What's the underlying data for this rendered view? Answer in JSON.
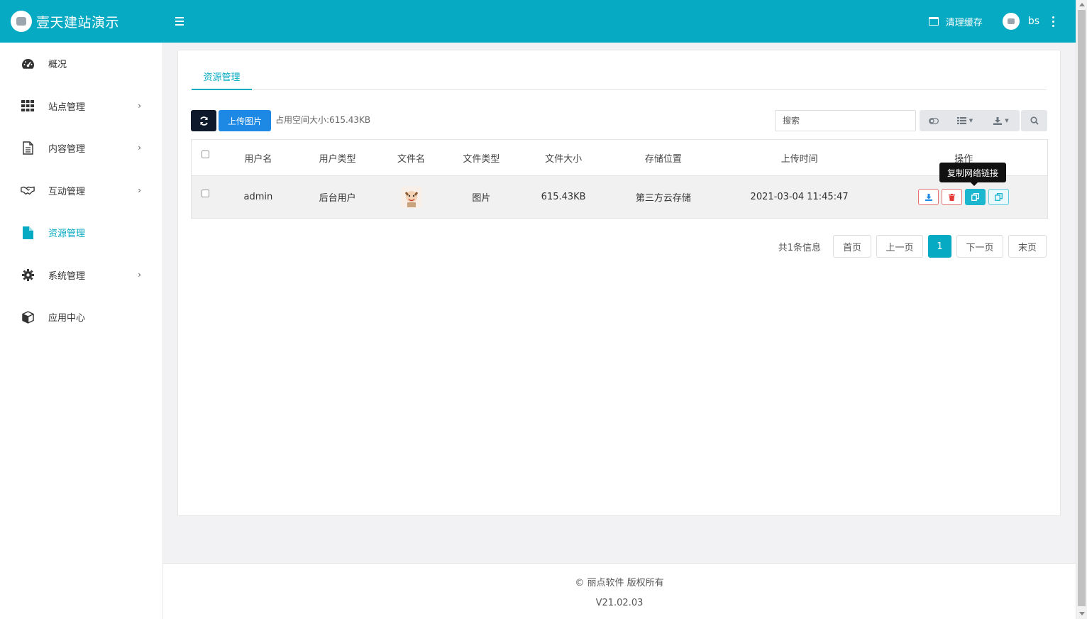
{
  "header": {
    "brand_title": "壹天建站演示",
    "clear_cache_label": "清理缓存",
    "user_name": "bs",
    "accent_color": "#06aac3"
  },
  "sidebar": {
    "items": [
      {
        "label": "概况",
        "icon": "dashboard-icon",
        "has_children": false
      },
      {
        "label": "站点管理",
        "icon": "grid-icon",
        "has_children": true
      },
      {
        "label": "内容管理",
        "icon": "document-icon",
        "has_children": true
      },
      {
        "label": "互动管理",
        "icon": "handshake-icon",
        "has_children": true
      },
      {
        "label": "资源管理",
        "icon": "file-icon",
        "has_children": false,
        "active": true
      },
      {
        "label": "系统管理",
        "icon": "gear-icon",
        "has_children": true
      },
      {
        "label": "应用中心",
        "icon": "cube-icon",
        "has_children": false
      }
    ],
    "chevron": "›"
  },
  "main": {
    "tab_label": "资源管理",
    "upload_label": "上传图片",
    "space_info": "占用空间大小:615.43KB",
    "search_placeholder": "搜索",
    "table": {
      "columns": [
        "用户名",
        "用户类型",
        "文件名",
        "文件类型",
        "文件大小",
        "存储位置",
        "上传时间",
        "操作"
      ],
      "rows": [
        {
          "username": "admin",
          "user_type": "后台用户",
          "file_type": "图片",
          "file_size": "615.43KB",
          "storage": "第三方云存储",
          "upload_time": "2021-03-04 11:45:47"
        }
      ]
    },
    "tooltip": "复制网络链接",
    "pagination": {
      "total_text": "共1条信息",
      "first": "首页",
      "prev": "上一页",
      "current": "1",
      "next": "下一页",
      "last": "末页"
    }
  },
  "footer": {
    "copyright": "© 丽点软件 版权所有",
    "version": "V21.02.03"
  }
}
